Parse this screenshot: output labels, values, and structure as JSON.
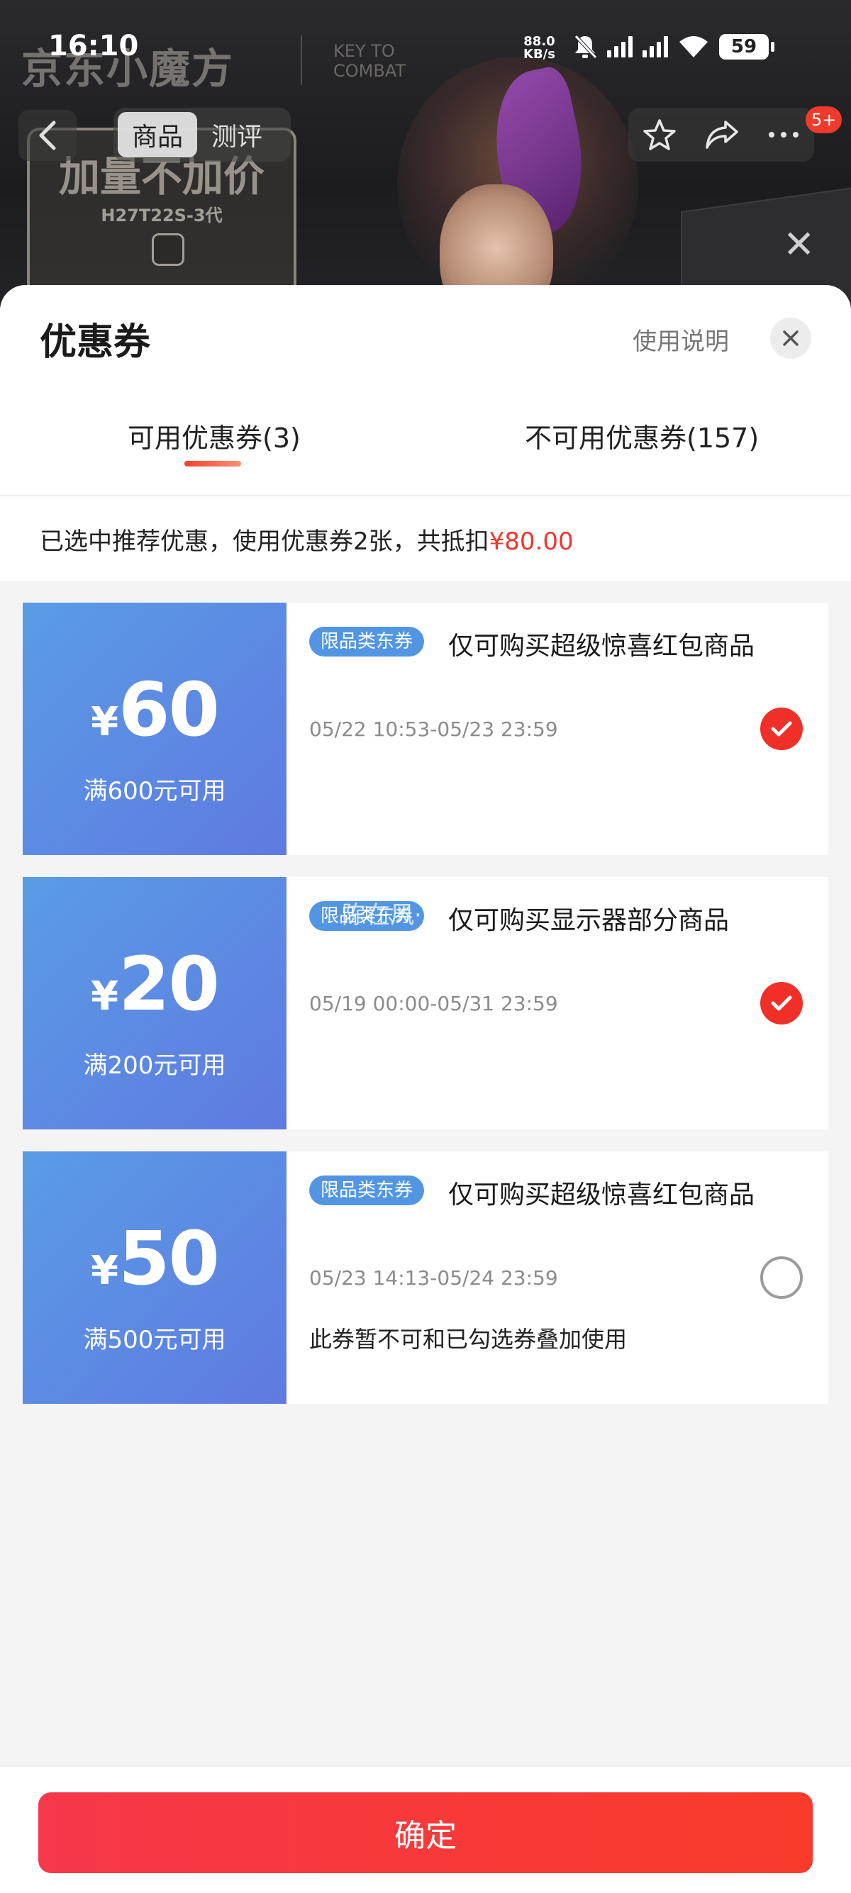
{
  "status_bar": {
    "time": "16:10",
    "net_speed_top": "88.0",
    "net_speed_bottom": "KB/s",
    "battery": "59"
  },
  "background_page": {
    "brand_logo": "京东小魔方",
    "brand_logo2_line1": "KEY TO",
    "brand_logo2_line2": "COMBAT",
    "badge_title": "加量不加价",
    "badge_sub": "H27T22S-3代",
    "nav": {
      "tabs": [
        "商品",
        "测评"
      ],
      "active_tab": 0,
      "more_badge": "5+"
    }
  },
  "sheet": {
    "title": "优惠券",
    "help_label": "使用说明",
    "tabs": [
      {
        "label": "可用优惠券(3)",
        "active": true
      },
      {
        "label": "不可用优惠券(157)",
        "active": false
      }
    ],
    "summary_prefix": "已选中推荐优惠，使用优惠券2张，共抵扣",
    "summary_amount": "¥80.00",
    "coupons": [
      {
        "currency": "¥",
        "amount": "60",
        "condition": "满600元可用",
        "tag": "限品类东券",
        "description": "仅可购买超级惊喜红包商品",
        "period": "05/22 10:53-05/23 23:59",
        "note": "",
        "selected": true
      },
      {
        "currency": "¥",
        "amount": "20",
        "condition": "满200元可用",
        "tag": "限品类东券",
        "description": "仅可购买显示器部分商品",
        "period": "05/19 00:00-05/31 23:59",
        "note": "",
        "selected": true,
        "overlay_text": "陈在风·冰"
      },
      {
        "currency": "¥",
        "amount": "50",
        "condition": "满500元可用",
        "tag": "限品类东券",
        "description": "仅可购买超级惊喜红包商品",
        "period": "05/23 14:13-05/24 23:59",
        "note": "此券暂不可和已勾选券叠加使用",
        "selected": false
      }
    ],
    "confirm_label": "确定"
  },
  "colors": {
    "accent_red": "#f2352b",
    "coupon_blue_start": "#5a9ce6",
    "coupon_blue_end": "#5f7ae0",
    "tag_blue": "#5296e3"
  }
}
